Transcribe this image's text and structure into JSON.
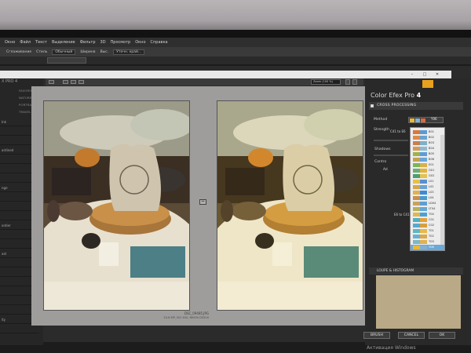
{
  "menubar": {
    "items": [
      "Окно",
      "Файл",
      "Текст",
      "Выделение",
      "Фильтр",
      "3D",
      "Просмотр",
      "Окно",
      "Справка"
    ]
  },
  "optionsbar": {
    "items": [
      "Сглаживание",
      "Стиль",
      "Обычный",
      "Ширина",
      "Выс.",
      "Уточн. край..."
    ]
  },
  "ps_tab": {
    "label": ""
  },
  "leftpanel": {
    "brand": "X PRO 4",
    "categories": [
      "FAVORITES",
      "NATURE",
      "PORTRAIT",
      "TRAVEL"
    ],
    "items": [
      "Ink",
      "",
      "",
      "ardined",
      "",
      "",
      "",
      "nge",
      "",
      "",
      "",
      "ontier",
      "",
      "",
      "ast",
      "",
      "",
      "",
      "",
      "",
      "",
      "ity",
      ""
    ]
  },
  "viewbar": {
    "zoom": "Zoom (100 %)"
  },
  "preview": {
    "filename": "DSC_09485.JPG",
    "info": "24.6 MP, ISO 400, NIKON D5500"
  },
  "rightpanel": {
    "title_text": "Color Efex Pro",
    "title_version": "4",
    "section": "CROSS PROCESSING",
    "method_label": "Method",
    "method_value": "Y06",
    "strength_label": "Strength",
    "range1": "C41 to E6",
    "range2": "E6 to C41",
    "shadows_label": "Shadows",
    "control_label": "Contro",
    "add_label": "Ad",
    "loupe_label": "LOUPE & HISTOGRAM",
    "dropdown": [
      {
        "code": "B01",
        "color": "#d97a3a",
        "color2": "#5a9bd0"
      },
      {
        "code": "B02",
        "color": "#e08a4a",
        "color2": "#6aa2cf"
      },
      {
        "code": "B03",
        "color": "#c77f52",
        "color2": "#7fb0c9"
      },
      {
        "code": "B04",
        "color": "#d39a55",
        "color2": "#8fbad2"
      },
      {
        "code": "B05",
        "color": "#9fb24e",
        "color2": "#5f9cd6"
      },
      {
        "code": "B06",
        "color": "#c4a24c",
        "color2": "#6aa6d8"
      },
      {
        "code": "E01",
        "color": "#7fb35a",
        "color2": "#d4b24c"
      },
      {
        "code": "G01",
        "color": "#6dad76",
        "color2": "#e4b23a"
      },
      {
        "code": "G02",
        "color": "#4e9e6f",
        "color2": "#e3c24f"
      },
      {
        "code": "L01",
        "color": "#e6c04a",
        "color2": "#5a8fd0"
      },
      {
        "code": "L02",
        "color": "#d7a54c",
        "color2": "#6aa2d6"
      },
      {
        "code": "L03",
        "color": "#e3b050",
        "color2": "#3f8ad4"
      },
      {
        "code": "L04",
        "color": "#c98f4c",
        "color2": "#4a9ad0"
      },
      {
        "code": "LD04",
        "color": "#c9a25b",
        "color2": "#5d9ed2"
      },
      {
        "code": "LT04",
        "color": "#b7b05c",
        "color2": "#65a8d4"
      },
      {
        "code": "T04",
        "color": "#e0b84f",
        "color2": "#4ea0d4"
      },
      {
        "code": "C01",
        "color": "#4fb0c7",
        "color2": "#e4a23a"
      },
      {
        "code": "C02",
        "color": "#58a9d1",
        "color2": "#d89f3f"
      },
      {
        "code": "T01",
        "color": "#5fb5c4",
        "color2": "#e8b84a"
      },
      {
        "code": "T02",
        "color": "#69b0d0",
        "color2": "#dba84a"
      },
      {
        "code": "T03",
        "color": "#7fb7c2",
        "color2": "#e0b250"
      },
      {
        "code": "Y06",
        "color": "#e8b83a",
        "color2": "#7fb0d6",
        "selected": true
      }
    ]
  },
  "buttons": {
    "brush": "BRUSH",
    "cancel": "CANCEL",
    "ok": "OK"
  },
  "watermark": "Активация Windows",
  "colors": {
    "accent": "#e8a21f",
    "selection": "#6aa9d8"
  }
}
